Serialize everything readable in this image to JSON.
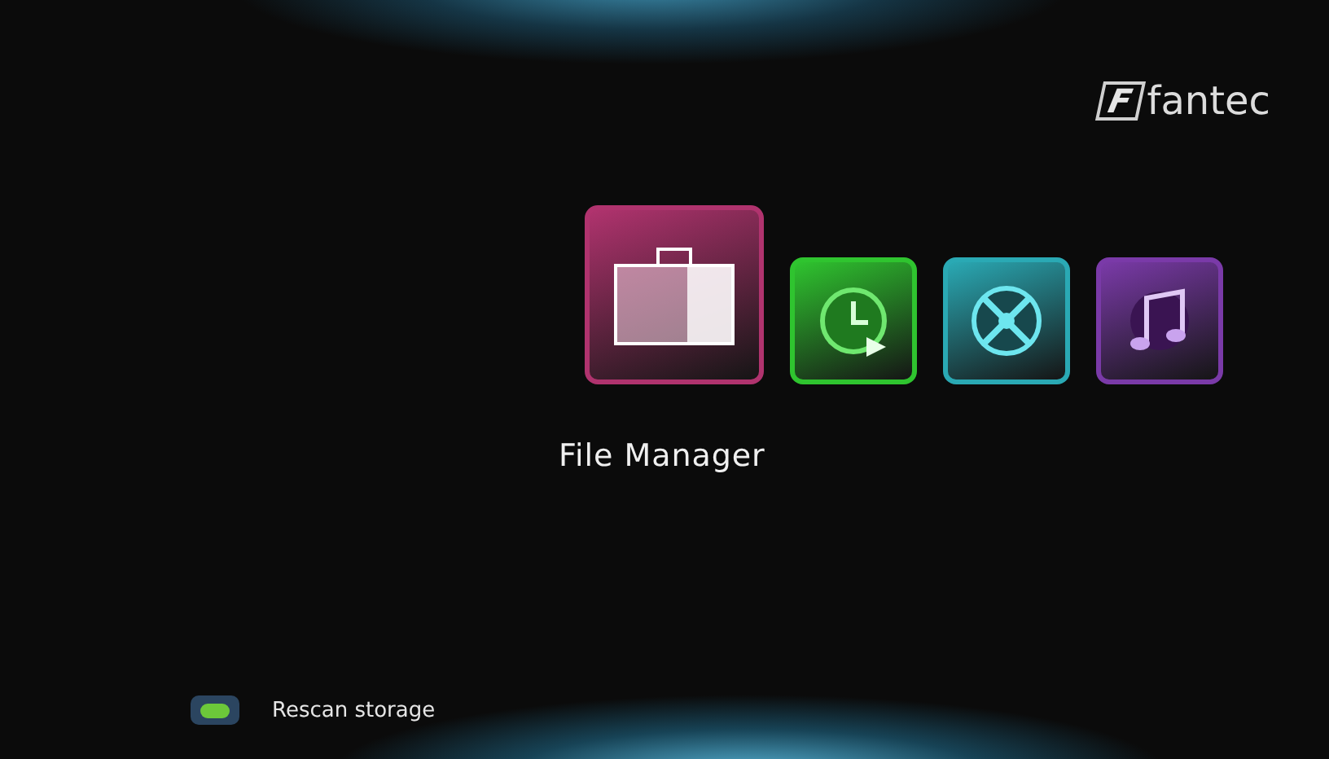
{
  "logo": {
    "mark": "F",
    "name": "fantec"
  },
  "menu": [
    {
      "kind": "briefcase",
      "selected": true,
      "color": "#b0336e"
    },
    {
      "kind": "clock",
      "selected": false,
      "color": "#2fc42f"
    },
    {
      "kind": "reel",
      "selected": false,
      "color": "#2aa9b4"
    },
    {
      "kind": "music",
      "selected": false,
      "color": "#7a3aa8"
    }
  ],
  "selected_label": "File Manager",
  "footer_hints": [
    {
      "color": "#6cc83a",
      "label": "Rescan storage"
    }
  ]
}
